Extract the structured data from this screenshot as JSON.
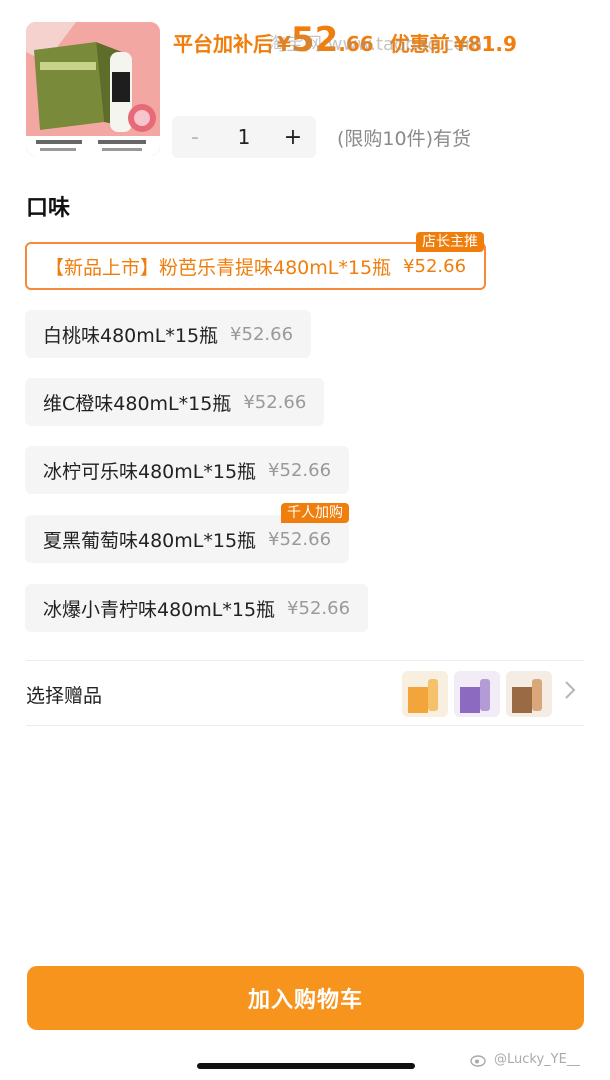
{
  "product": {
    "image_icon": "beverage-case-with-bottle",
    "price_label": "平台加补后",
    "price_currency": "¥",
    "price_integer": "52",
    "price_decimal": ".66",
    "original_label": "优惠前",
    "original_price": "¥81.9",
    "watermark_text": "淘宝网 www.taobao.com",
    "accent_color": "#f07e0d"
  },
  "quantity": {
    "minus": "-",
    "value": "1",
    "plus": "+",
    "limit_note": "(限购10件)有货"
  },
  "flavor": {
    "title": "口味",
    "options": [
      {
        "name": "【新品上市】粉芭乐青提味480mL*15瓶",
        "price": "¥52.66",
        "badge": "店长主推",
        "selected": true
      },
      {
        "name": "白桃味480mL*15瓶",
        "price": "¥52.66",
        "badge": "",
        "selected": false
      },
      {
        "name": "维C橙味480mL*15瓶",
        "price": "¥52.66",
        "badge": "",
        "selected": false
      },
      {
        "name": "冰柠可乐味480mL*15瓶",
        "price": "¥52.66",
        "badge": "",
        "selected": false
      },
      {
        "name": "夏黑葡萄味480mL*15瓶",
        "price": "¥52.66",
        "badge": "千人加购",
        "selected": false
      },
      {
        "name": "冰爆小青柠味480mL*15瓶",
        "price": "¥52.66",
        "badge": "",
        "selected": false
      }
    ]
  },
  "gift": {
    "label": "选择赠品",
    "thumbs": [
      "gift-thumb-orange",
      "gift-thumb-purple",
      "gift-thumb-brown"
    ],
    "arrow_icon": "chevron-right-icon"
  },
  "cart_button_label": "加入购物车",
  "credit_text": "@Lucky_YE__"
}
